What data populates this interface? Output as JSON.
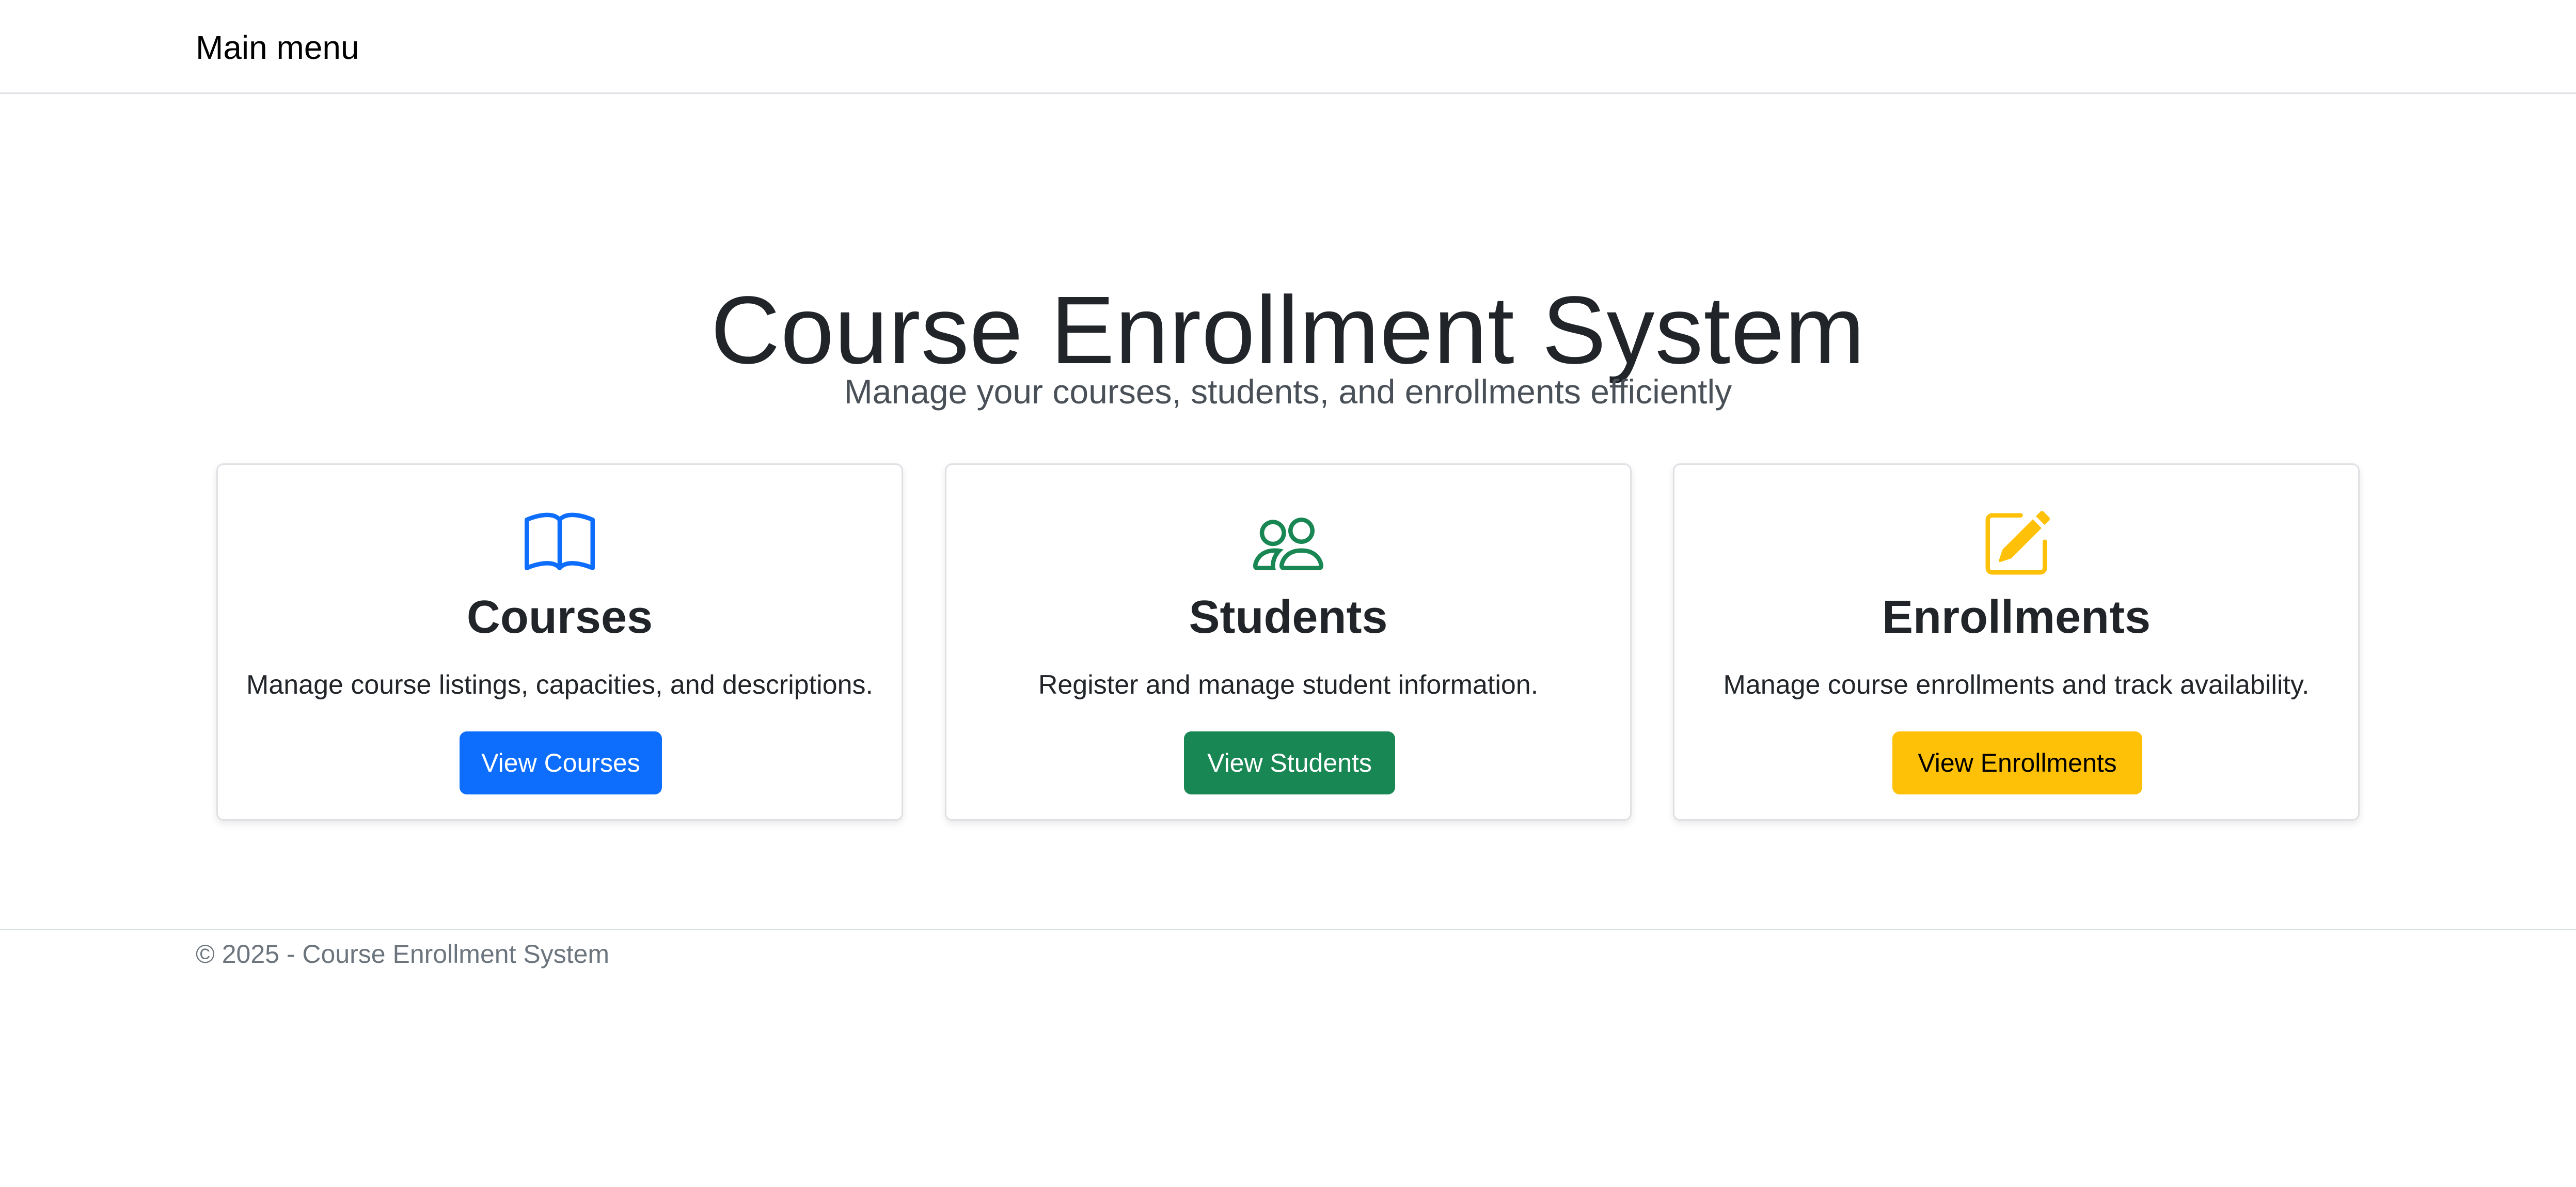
{
  "navbar": {
    "brand": "Main menu"
  },
  "hero": {
    "title": "Course Enrollment System",
    "subtitle": "Manage your courses, students, and enrollments efficiently"
  },
  "cards": [
    {
      "icon": "book-icon",
      "title": "Courses",
      "description": "Manage course listings, capacities, and descriptions.",
      "button_label": "View Courses",
      "accent": "#0d6efd"
    },
    {
      "icon": "people-icon",
      "title": "Students",
      "description": "Register and manage student information.",
      "button_label": "View Students",
      "accent": "#198754"
    },
    {
      "icon": "pencil-square-icon",
      "title": "Enrollments",
      "description": "Manage course enrollments and track availability.",
      "button_label": "View Enrollments",
      "accent": "#ffc107"
    }
  ],
  "footer": {
    "copyright": "© 2025 - Course Enrollment System"
  }
}
